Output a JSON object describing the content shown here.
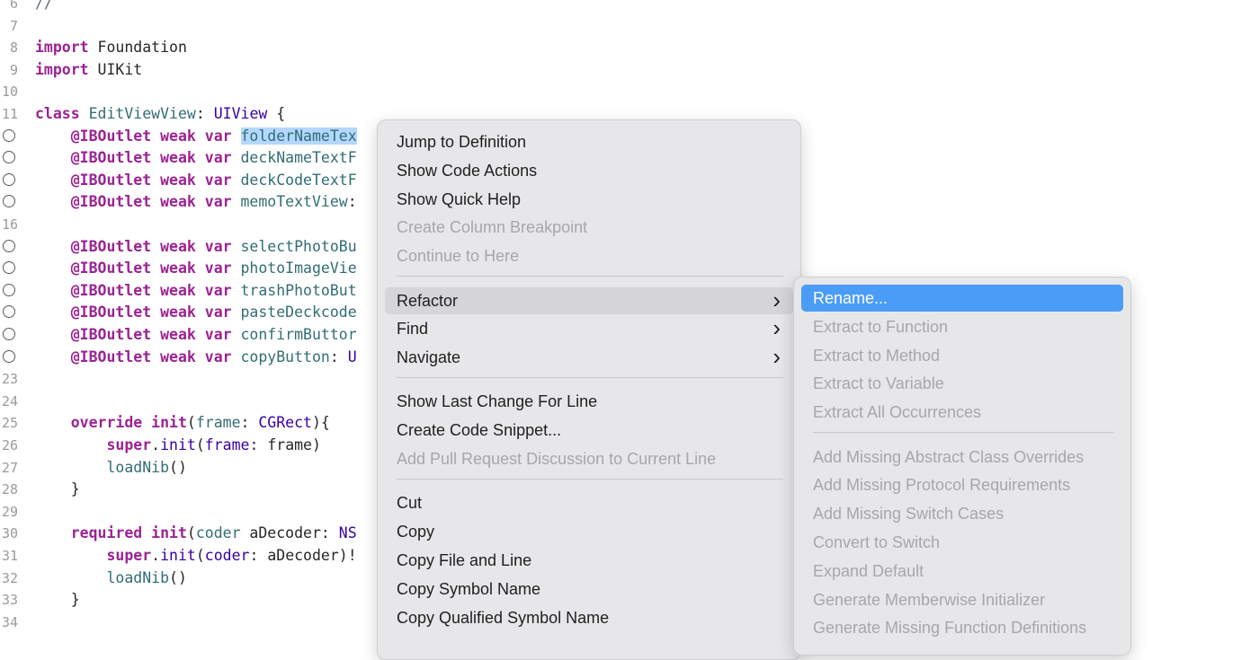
{
  "code_lines": [
    {
      "n": "6",
      "outlet": false,
      "tokens": [
        {
          "t": "//",
          "c": "com"
        }
      ]
    },
    {
      "n": "7",
      "outlet": false,
      "tokens": []
    },
    {
      "n": "8",
      "outlet": false,
      "tokens": [
        {
          "t": "import",
          "c": "kw"
        },
        {
          "t": " Foundation",
          "c": "pl"
        }
      ]
    },
    {
      "n": "9",
      "outlet": false,
      "tokens": [
        {
          "t": "import",
          "c": "kw"
        },
        {
          "t": " UIKit",
          "c": "pl"
        }
      ]
    },
    {
      "n": "10",
      "outlet": false,
      "tokens": []
    },
    {
      "n": "11",
      "outlet": false,
      "tokens": [
        {
          "t": "class",
          "c": "kw"
        },
        {
          "t": " ",
          "c": "pl"
        },
        {
          "t": "EditViewView",
          "c": "fn"
        },
        {
          "t": ": ",
          "c": "pl"
        },
        {
          "t": "UIView",
          "c": "ty"
        },
        {
          "t": " {",
          "c": "pl"
        }
      ]
    },
    {
      "n": "",
      "outlet": true,
      "tokens": [
        {
          "t": "    ",
          "c": "pl"
        },
        {
          "t": "@IBOutlet weak var",
          "c": "kw"
        },
        {
          "t": " ",
          "c": "pl"
        },
        {
          "t": "folderNameTex",
          "c": "fn hl"
        }
      ]
    },
    {
      "n": "",
      "outlet": true,
      "tokens": [
        {
          "t": "    ",
          "c": "pl"
        },
        {
          "t": "@IBOutlet weak var",
          "c": "kw"
        },
        {
          "t": " ",
          "c": "pl"
        },
        {
          "t": "deckNameTextF",
          "c": "fn"
        }
      ]
    },
    {
      "n": "",
      "outlet": true,
      "tokens": [
        {
          "t": "    ",
          "c": "pl"
        },
        {
          "t": "@IBOutlet weak var",
          "c": "kw"
        },
        {
          "t": " ",
          "c": "pl"
        },
        {
          "t": "deckCodeTextF",
          "c": "fn"
        }
      ]
    },
    {
      "n": "",
      "outlet": true,
      "tokens": [
        {
          "t": "    ",
          "c": "pl"
        },
        {
          "t": "@IBOutlet weak var",
          "c": "kw"
        },
        {
          "t": " ",
          "c": "pl"
        },
        {
          "t": "memoTextView",
          "c": "fn"
        },
        {
          "t": ":",
          "c": "pl"
        }
      ]
    },
    {
      "n": "16",
      "outlet": false,
      "tokens": []
    },
    {
      "n": "",
      "outlet": true,
      "tokens": [
        {
          "t": "    ",
          "c": "pl"
        },
        {
          "t": "@IBOutlet weak var",
          "c": "kw"
        },
        {
          "t": " ",
          "c": "pl"
        },
        {
          "t": "selectPhotoBu",
          "c": "fn"
        }
      ]
    },
    {
      "n": "",
      "outlet": true,
      "tokens": [
        {
          "t": "    ",
          "c": "pl"
        },
        {
          "t": "@IBOutlet weak var",
          "c": "kw"
        },
        {
          "t": " ",
          "c": "pl"
        },
        {
          "t": "photoImageVie",
          "c": "fn"
        }
      ]
    },
    {
      "n": "",
      "outlet": true,
      "tokens": [
        {
          "t": "    ",
          "c": "pl"
        },
        {
          "t": "@IBOutlet weak var",
          "c": "kw"
        },
        {
          "t": " ",
          "c": "pl"
        },
        {
          "t": "trashPhotoBut",
          "c": "fn"
        }
      ]
    },
    {
      "n": "",
      "outlet": true,
      "tokens": [
        {
          "t": "    ",
          "c": "pl"
        },
        {
          "t": "@IBOutlet weak var",
          "c": "kw"
        },
        {
          "t": " ",
          "c": "pl"
        },
        {
          "t": "pasteDeckcode",
          "c": "fn"
        }
      ]
    },
    {
      "n": "",
      "outlet": true,
      "tokens": [
        {
          "t": "    ",
          "c": "pl"
        },
        {
          "t": "@IBOutlet weak var",
          "c": "kw"
        },
        {
          "t": " ",
          "c": "pl"
        },
        {
          "t": "confirmButtor",
          "c": "fn"
        }
      ]
    },
    {
      "n": "",
      "outlet": true,
      "tokens": [
        {
          "t": "    ",
          "c": "pl"
        },
        {
          "t": "@IBOutlet weak var",
          "c": "kw"
        },
        {
          "t": " ",
          "c": "pl"
        },
        {
          "t": "copyButton",
          "c": "fn"
        },
        {
          "t": ": ",
          "c": "pl"
        },
        {
          "t": "U",
          "c": "ty"
        }
      ]
    },
    {
      "n": "23",
      "outlet": false,
      "tokens": []
    },
    {
      "n": "24",
      "outlet": false,
      "tokens": []
    },
    {
      "n": "25",
      "outlet": false,
      "tokens": [
        {
          "t": "    ",
          "c": "pl"
        },
        {
          "t": "override init",
          "c": "kw"
        },
        {
          "t": "(",
          "c": "pl"
        },
        {
          "t": "frame",
          "c": "fn"
        },
        {
          "t": ": ",
          "c": "pl"
        },
        {
          "t": "CGRect",
          "c": "ty"
        },
        {
          "t": "){",
          "c": "pl"
        }
      ]
    },
    {
      "n": "26",
      "outlet": false,
      "tokens": [
        {
          "t": "        ",
          "c": "pl"
        },
        {
          "t": "super",
          "c": "kw"
        },
        {
          "t": ".",
          "c": "pl"
        },
        {
          "t": "init",
          "c": "ty"
        },
        {
          "t": "(",
          "c": "pl"
        },
        {
          "t": "frame",
          "c": "ty"
        },
        {
          "t": ": frame)",
          "c": "pl"
        }
      ]
    },
    {
      "n": "27",
      "outlet": false,
      "tokens": [
        {
          "t": "        ",
          "c": "pl"
        },
        {
          "t": "loadNib",
          "c": "fn"
        },
        {
          "t": "()",
          "c": "pl"
        }
      ]
    },
    {
      "n": "28",
      "outlet": false,
      "tokens": [
        {
          "t": "    }",
          "c": "pl"
        }
      ]
    },
    {
      "n": "29",
      "outlet": false,
      "tokens": []
    },
    {
      "n": "30",
      "outlet": false,
      "tokens": [
        {
          "t": "    ",
          "c": "pl"
        },
        {
          "t": "required init",
          "c": "kw"
        },
        {
          "t": "(",
          "c": "pl"
        },
        {
          "t": "coder",
          "c": "fn"
        },
        {
          "t": " aDecoder: ",
          "c": "pl"
        },
        {
          "t": "NS",
          "c": "ty"
        }
      ]
    },
    {
      "n": "31",
      "outlet": false,
      "tokens": [
        {
          "t": "        ",
          "c": "pl"
        },
        {
          "t": "super",
          "c": "kw"
        },
        {
          "t": ".",
          "c": "pl"
        },
        {
          "t": "init",
          "c": "ty"
        },
        {
          "t": "(",
          "c": "pl"
        },
        {
          "t": "coder",
          "c": "ty"
        },
        {
          "t": ": aDecoder)!",
          "c": "pl"
        }
      ]
    },
    {
      "n": "32",
      "outlet": false,
      "tokens": [
        {
          "t": "        ",
          "c": "pl"
        },
        {
          "t": "loadNib",
          "c": "fn"
        },
        {
          "t": "()",
          "c": "pl"
        }
      ]
    },
    {
      "n": "33",
      "outlet": false,
      "tokens": [
        {
          "t": "    }",
          "c": "pl"
        }
      ]
    },
    {
      "n": "34",
      "outlet": false,
      "tokens": []
    }
  ],
  "context_menu": {
    "items": [
      {
        "label": "Jump to Definition",
        "disabled": false,
        "submenu": false
      },
      {
        "label": "Show Code Actions",
        "disabled": false,
        "submenu": false
      },
      {
        "label": "Show Quick Help",
        "disabled": false,
        "submenu": false
      },
      {
        "label": "Create Column Breakpoint",
        "disabled": true,
        "submenu": false
      },
      {
        "label": "Continue to Here",
        "disabled": true,
        "submenu": false
      },
      {
        "separator": true
      },
      {
        "label": "Refactor",
        "disabled": false,
        "submenu": true,
        "state": "hover"
      },
      {
        "label": "Find",
        "disabled": false,
        "submenu": true
      },
      {
        "label": "Navigate",
        "disabled": false,
        "submenu": true
      },
      {
        "separator": true
      },
      {
        "label": "Show Last Change For Line",
        "disabled": false,
        "submenu": false
      },
      {
        "label": "Create Code Snippet...",
        "disabled": false,
        "submenu": false
      },
      {
        "label": "Add Pull Request Discussion to Current Line",
        "disabled": true,
        "submenu": false
      },
      {
        "separator": true
      },
      {
        "label": "Cut",
        "disabled": false,
        "submenu": false
      },
      {
        "label": "Copy",
        "disabled": false,
        "submenu": false
      },
      {
        "label": "Copy File and Line",
        "disabled": false,
        "submenu": false
      },
      {
        "label": "Copy Symbol Name",
        "disabled": false,
        "submenu": false
      },
      {
        "label": "Copy Qualified Symbol Name",
        "disabled": false,
        "submenu": false
      }
    ]
  },
  "refactor_submenu": {
    "items": [
      {
        "label": "Rename...",
        "disabled": false,
        "state": "selected"
      },
      {
        "label": "Extract to Function",
        "disabled": true
      },
      {
        "label": "Extract to Method",
        "disabled": true
      },
      {
        "label": "Extract to Variable",
        "disabled": true
      },
      {
        "label": "Extract All Occurrences",
        "disabled": true
      },
      {
        "separator": true
      },
      {
        "label": "Add Missing Abstract Class Overrides",
        "disabled": true
      },
      {
        "label": "Add Missing Protocol Requirements",
        "disabled": true
      },
      {
        "label": "Add Missing Switch Cases",
        "disabled": true
      },
      {
        "label": "Convert to Switch",
        "disabled": true
      },
      {
        "label": "Expand Default",
        "disabled": true
      },
      {
        "label": "Generate Memberwise Initializer",
        "disabled": true
      },
      {
        "label": "Generate Missing Function Definitions",
        "disabled": true
      }
    ]
  },
  "colors": {
    "keyword": "#9b2393",
    "type": "#3900a0",
    "identifier": "#326d74",
    "selection": "#b3d7ff",
    "menu_highlight": "#4a9cf7"
  },
  "icons": {
    "outlet": "outlet-connection-circle-icon",
    "submenu": "chevron-right-icon"
  }
}
